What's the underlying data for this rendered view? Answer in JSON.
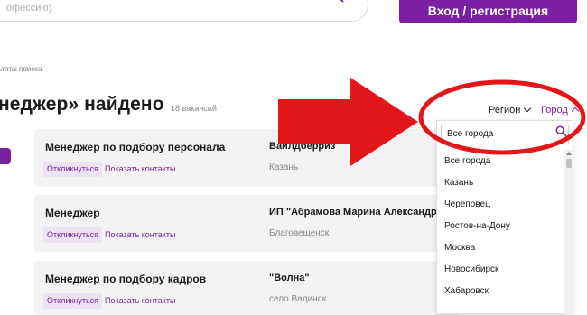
{
  "header": {
    "search_placeholder": "офессию)",
    "login_button": "Вход / регистрация"
  },
  "breadcrumb": "ьтаты поиска",
  "results": {
    "title": "неджер» найдено",
    "count": "18 вакансий"
  },
  "cards": [
    {
      "title": "Менеджер по подбору персонала",
      "company": "Вайлдберриз",
      "city": "Казань",
      "respond_label": "Откликнуться",
      "contacts_label": "Показать контакты"
    },
    {
      "title": "Менеджер",
      "company": "ИП \"Абрамова Марина Александров",
      "city": "Благовещенск",
      "respond_label": "Откликнуться",
      "contacts_label": "Показать контакты"
    },
    {
      "title": "Менеджер по подбору кадров",
      "company": "\"Волна\"",
      "city": "село Вадинск",
      "respond_label": "Откликнуться",
      "contacts_label": "Показать контакты"
    }
  ],
  "filters": {
    "region_label": "Регион",
    "city_label": "Город"
  },
  "city_dropdown": {
    "input_value": "Все города",
    "options": [
      "Все города",
      "Казань",
      "Череповец",
      "Ростов-на-Дону",
      "Москва",
      "Новосибирск",
      "Хабаровск"
    ]
  },
  "colors": {
    "accent": "#7b1fa2",
    "annotation_red": "#e3161b"
  },
  "icons": {
    "search": "search-icon",
    "dropdown_search": "search-icon",
    "region_chevron": "chevron-down-icon",
    "city_chevron": "chevron-up-icon",
    "annotation_arrow": "arrow-right-icon"
  }
}
